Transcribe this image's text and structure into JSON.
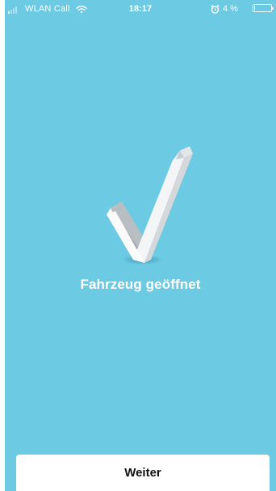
{
  "status_bar": {
    "carrier": "WLAN Call",
    "time": "18:17",
    "battery_text": "4 %",
    "battery_level": 0.04,
    "icons": [
      "signal-icon",
      "wifi-icon",
      "alarm-icon",
      "battery-icon"
    ]
  },
  "main": {
    "message": "Fahrzeug geöffnet",
    "icon": "checkmark-icon"
  },
  "footer": {
    "continue_label": "Weiter"
  },
  "colors": {
    "background": "#6dcae3",
    "button_background": "#ffffff",
    "text_light": "#ffffff",
    "button_text": "#111111"
  }
}
